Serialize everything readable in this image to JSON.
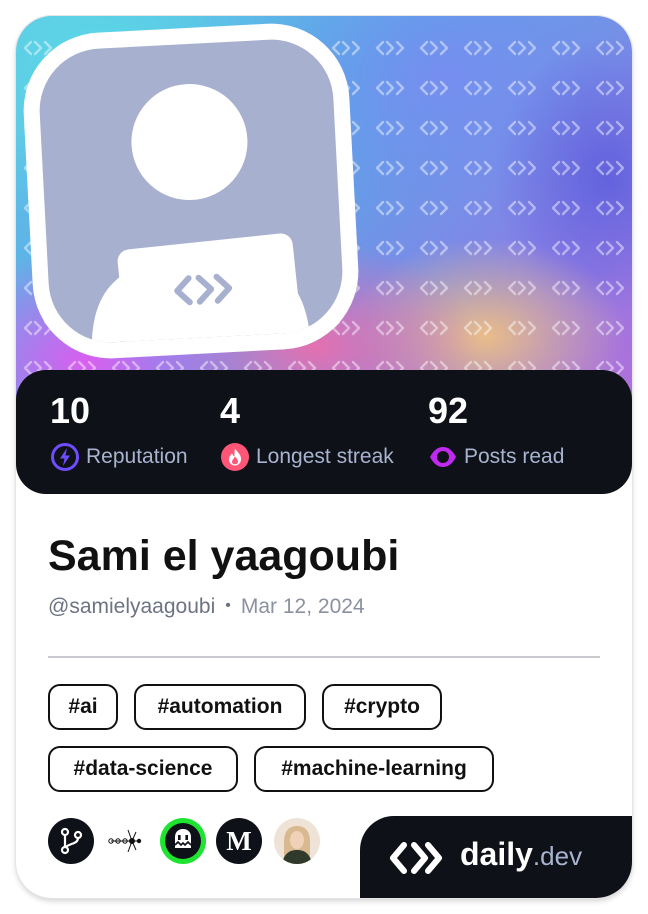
{
  "profile": {
    "name": "Sami el yaagoubi",
    "handle": "@samielyaagoubi",
    "separator": "•",
    "joined": "Mar 12, 2024"
  },
  "stats": [
    {
      "value": "10",
      "label": "Reputation",
      "icon": "reputation-bolt-icon",
      "color": "#6e4dff"
    },
    {
      "value": "4",
      "label": "Longest streak",
      "icon": "streak-flame-icon",
      "color": "#ff5678"
    },
    {
      "value": "92",
      "label": "Posts read",
      "icon": "posts-read-eye-icon",
      "color": "#c029f0"
    }
  ],
  "tags": [
    "#ai",
    "#automation",
    "#crypto",
    "#data-science",
    "#machine-learning"
  ],
  "stack": [
    "git-icon",
    "neural-network-icon",
    "android-badge-icon",
    "medium-logo-icon",
    "user-photo-avatar"
  ],
  "brand": {
    "daily": "daily",
    "dev": ".dev"
  },
  "colors": {
    "card_dark": "#0e1117",
    "avatar_bg": "#a7b1cf",
    "accent_green": "#1ee330"
  }
}
